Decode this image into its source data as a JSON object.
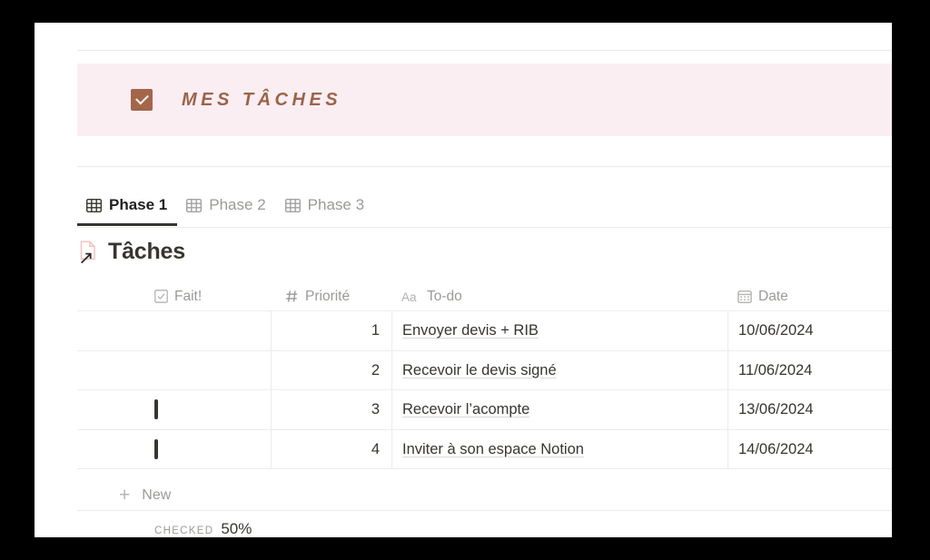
{
  "callout": {
    "icon": "checkbox-checked-icon",
    "title": "MES TÂCHES",
    "background_color": "#fbeef3",
    "icon_color": "#a4664a",
    "text_color": "#9c6349"
  },
  "tabs": [
    {
      "label": "Phase 1",
      "icon": "table-grid-icon",
      "active": true
    },
    {
      "label": "Phase 2",
      "icon": "table-grid-icon",
      "active": false
    },
    {
      "label": "Phase 3",
      "icon": "table-grid-icon",
      "active": false
    }
  ],
  "database": {
    "icon": "linked-page-arrow-icon",
    "title": "Tâches",
    "columns": [
      {
        "key": "done",
        "label": "Fait!",
        "icon": "checkbox-property-icon"
      },
      {
        "key": "prio",
        "label": "Priorité",
        "icon": "number-hash-icon"
      },
      {
        "key": "todo",
        "label": "To-do",
        "icon": "text-aa-icon"
      },
      {
        "key": "date",
        "label": "Date",
        "icon": "calendar-icon"
      },
      {
        "key": "extra",
        "label": "",
        "icon": "text-lines-icon"
      }
    ],
    "rows": [
      {
        "done": true,
        "prio": "1",
        "todo": "Envoyer devis + RIB",
        "date": "10/06/2024"
      },
      {
        "done": true,
        "prio": "2",
        "todo": "Recevoir le devis signé",
        "date": "11/06/2024"
      },
      {
        "done": false,
        "prio": "3",
        "todo": "Recevoir l’acompte",
        "date": "13/06/2024"
      },
      {
        "done": false,
        "prio": "4",
        "todo": "Inviter à son espace Notion",
        "date": "14/06/2024"
      }
    ],
    "new_row_label": "New",
    "new_row_icon": "plus-icon",
    "summary": {
      "label": "CHECKED",
      "value": "50%"
    },
    "checkbox_checked_color": "#2f86de"
  }
}
